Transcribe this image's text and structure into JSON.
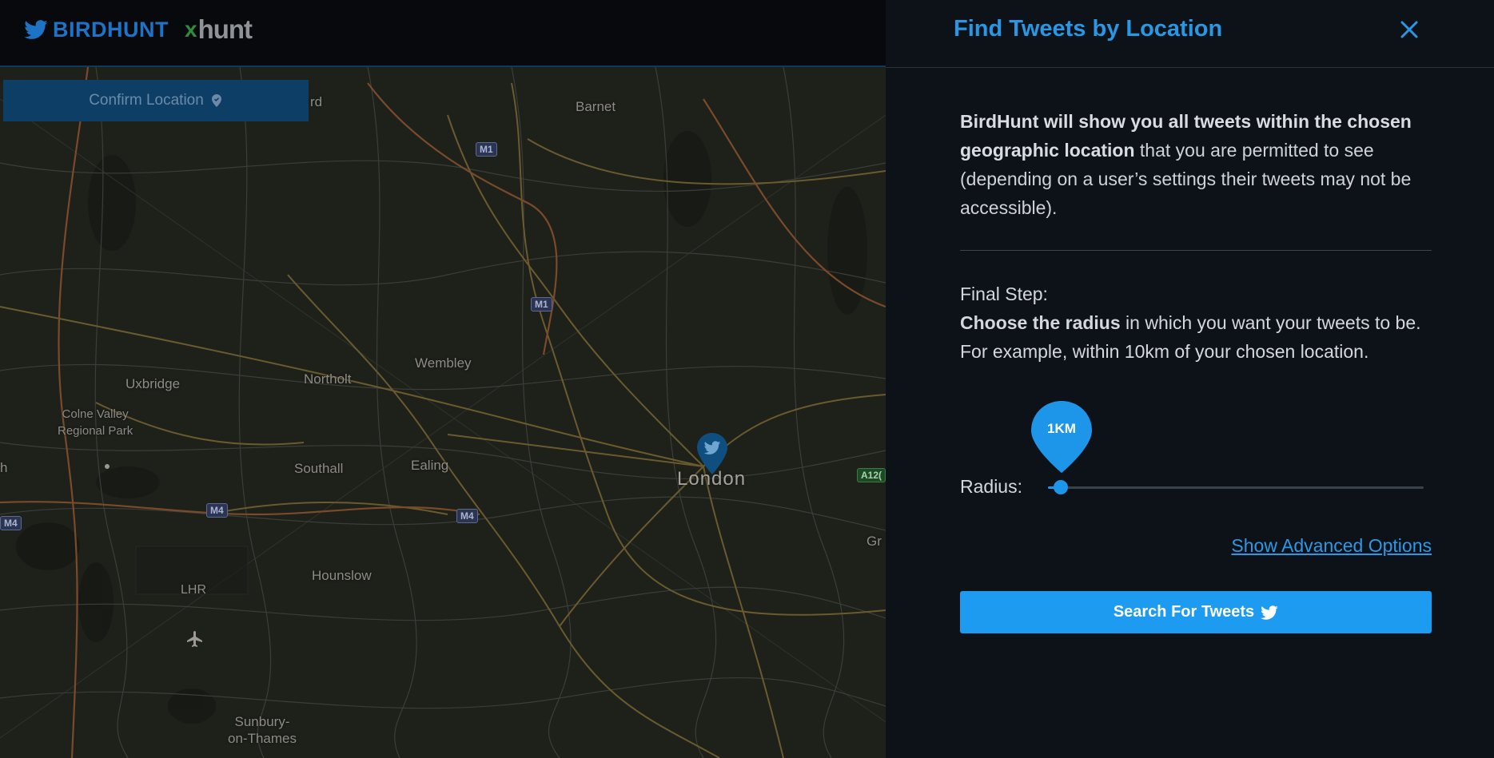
{
  "header": {
    "brand_birdhunt": "BIRDHUNT",
    "brand_xhunt_x": "x",
    "brand_xhunt": "hunt"
  },
  "map": {
    "confirm_label": "Confirm Location",
    "places": {
      "barnet": "Barnet",
      "uxbridge": "Uxbridge",
      "colne_valley": "Colne Valley",
      "regional_park": "Regional Park",
      "northolt": "Northolt",
      "wembley": "Wembley",
      "southall": "Southall",
      "ealing": "Ealing",
      "london": "London",
      "hounslow": "Hounslow",
      "lhr": "LHR",
      "sunbury": "Sunbury-",
      "on_thames": "on-Thames",
      "edge_rd": "rd",
      "edge_h": "h",
      "edge_gr": "Gr"
    },
    "roads": {
      "m1_top": "M1",
      "m1_mid": "M1",
      "m4_left": "M4",
      "m4_mid": "M4",
      "m4_edge": "M4",
      "a12": "A12("
    }
  },
  "panel": {
    "title": "Find Tweets by Location",
    "intro_bold": "BirdHunt will show you all tweets within the chosen geographic location",
    "intro_rest": " that you are permitted to see (depending on a user’s settings their tweets may not be accessible).",
    "step_title": "Final Step:",
    "step_bold": "Choose the radius",
    "step_rest": " in which you want your tweets to be. For example, within 10km of your chosen location.",
    "radius_label": "Radius:",
    "radius_value": "1KM",
    "radius_fraction": 0.02,
    "advanced_link": "Show Advanced Options",
    "search_label": "Search For Tweets"
  },
  "colors": {
    "accent": "#1d9bf0",
    "title": "#2a97e4",
    "confirm_bg": "#0d3f66"
  }
}
